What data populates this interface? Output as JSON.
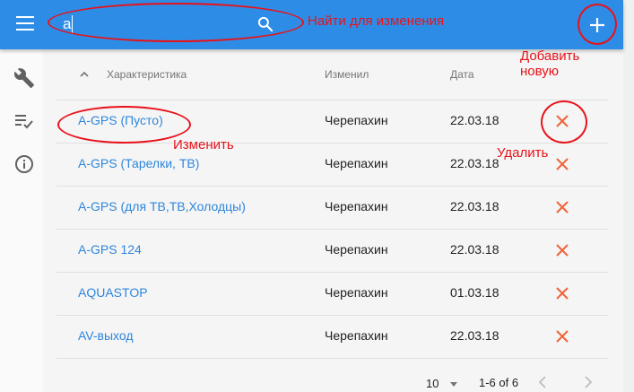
{
  "topbar": {
    "search_value": "a",
    "icons": [
      "menu-icon",
      "search-icon",
      "plus-icon"
    ]
  },
  "sidebar": {
    "icons": [
      "wrench-icon",
      "checklist-icon",
      "info-icon"
    ]
  },
  "table": {
    "headers": {
      "name": "Характеристика",
      "user": "Изменил",
      "date": "Дата"
    },
    "rows": [
      {
        "name": "A-GPS (Пусто)",
        "user": "Черепахин",
        "date": "22.03.18"
      },
      {
        "name": "A-GPS (Тарелки, ТВ)",
        "user": "Черепахин",
        "date": "22.03.18"
      },
      {
        "name": "A-GPS (для ТВ,ТВ,Холодцы)",
        "user": "Черепахин",
        "date": "22.03.18"
      },
      {
        "name": "A-GPS 124",
        "user": "Черепахин",
        "date": "22.03.18"
      },
      {
        "name": "AQUASTOP",
        "user": "Черепахин",
        "date": "01.03.18"
      },
      {
        "name": "AV-выход",
        "user": "Черепахин",
        "date": "22.03.18"
      }
    ]
  },
  "pagination": {
    "rows_per_page": "10",
    "range": "1-6 of 6"
  },
  "annotations": {
    "search": "Найти для изменения",
    "add": "Добавить новую",
    "edit": "Изменить",
    "delete": "Удалить"
  },
  "colors": {
    "topbar": "#2d8de6",
    "link": "#2d86dd",
    "delete": "#f0643c",
    "annotation": "#e8121a"
  }
}
